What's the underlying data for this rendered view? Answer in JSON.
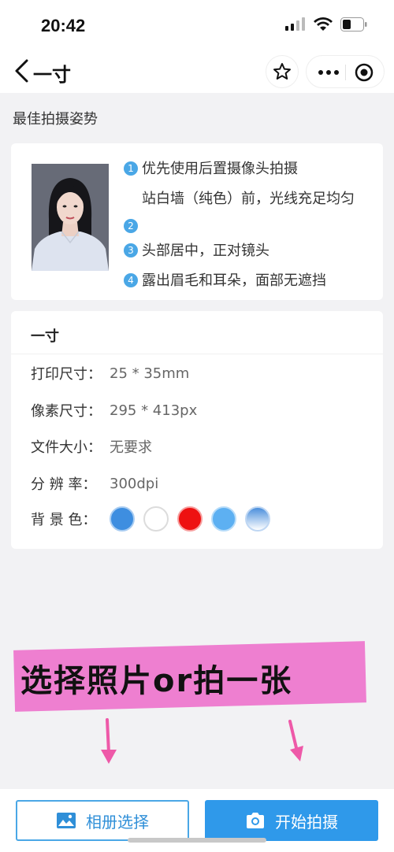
{
  "status": {
    "time": "20:42"
  },
  "nav": {
    "title": "一寸"
  },
  "section": {
    "title": "最佳拍摄姿势"
  },
  "tips": [
    {
      "num": "1",
      "text": "优先使用后置摄像头拍摄"
    },
    {
      "num": "2",
      "text": "站白墙（纯色）前，光线充足均匀"
    },
    {
      "num": "3",
      "text": "头部居中，正对镜头"
    },
    {
      "num": "4",
      "text": "露出眉毛和耳朵，面部无遮挡"
    }
  ],
  "spec": {
    "title": "一寸",
    "rows": [
      {
        "key": "打印尺寸：",
        "value": "25 * 35mm"
      },
      {
        "key": "像素尺寸：",
        "value": "295 * 413px"
      },
      {
        "key": "文件大小：",
        "value": "无要求"
      },
      {
        "key": "分 辨 率：",
        "value": "300dpi"
      }
    ],
    "bg_label": "背 景 色：",
    "bg_colors": [
      "#3e8ee0",
      "#ffffff",
      "#ee1111",
      "#5db0f2",
      "gradient"
    ]
  },
  "overlay": {
    "text": "选择照片or拍一张",
    "color": "#ee7fd0"
  },
  "buttons": {
    "album": "相册选择",
    "shoot": "开始拍摄"
  },
  "colors": {
    "accent": "#2f99ea",
    "tip_bullet": "#4aa7e6"
  }
}
